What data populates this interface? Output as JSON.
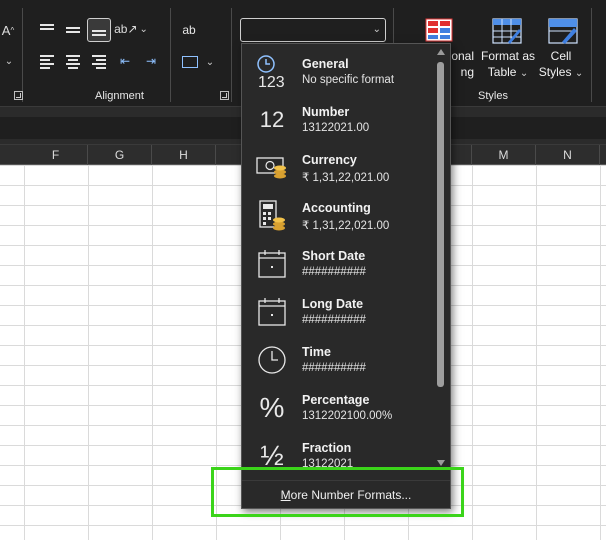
{
  "ribbon": {
    "alignment_label": "Alignment",
    "styles_label": "Styles",
    "font_a_label": "A",
    "wrap_label": "ab",
    "number_format_value": "",
    "conditional_label_line1": "onal",
    "conditional_label_line2": "ng",
    "format_as_table_line1": "Format as",
    "format_as_table_line2": "Table",
    "cell_styles_line1": "Cell",
    "cell_styles_line2": "Styles"
  },
  "columns": [
    "F",
    "G",
    "H",
    "",
    "",
    "",
    "M",
    "N"
  ],
  "dropdown": {
    "items": [
      {
        "icon": "clock-123-icon",
        "title": "General",
        "sub": "No specific format"
      },
      {
        "icon": "number-12-icon",
        "title": "Number",
        "sub": "13122021.00"
      },
      {
        "icon": "currency-icon",
        "title": "Currency",
        "sub": "₹ 1,31,22,021.00"
      },
      {
        "icon": "accounting-icon",
        "title": "Accounting",
        "sub": "₹ 1,31,22,021.00"
      },
      {
        "icon": "short-date-icon",
        "title": "Short Date",
        "sub": "##########"
      },
      {
        "icon": "long-date-icon",
        "title": "Long Date",
        "sub": "##########"
      },
      {
        "icon": "time-icon",
        "title": "Time",
        "sub": "##########"
      },
      {
        "icon": "percent-icon",
        "title": "Percentage",
        "sub": "1312202100.00%"
      },
      {
        "icon": "fraction-icon",
        "title": "Fraction",
        "sub": "13122021"
      }
    ],
    "glyphs": {
      "number": "12",
      "general": "123",
      "percent": "%",
      "fraction": "½"
    },
    "more_label": "More Number Formats..."
  },
  "colors": {
    "highlight": "#3bd41a",
    "ribbon_bg": "#1f1f1f",
    "dropdown_bg": "#292929"
  }
}
